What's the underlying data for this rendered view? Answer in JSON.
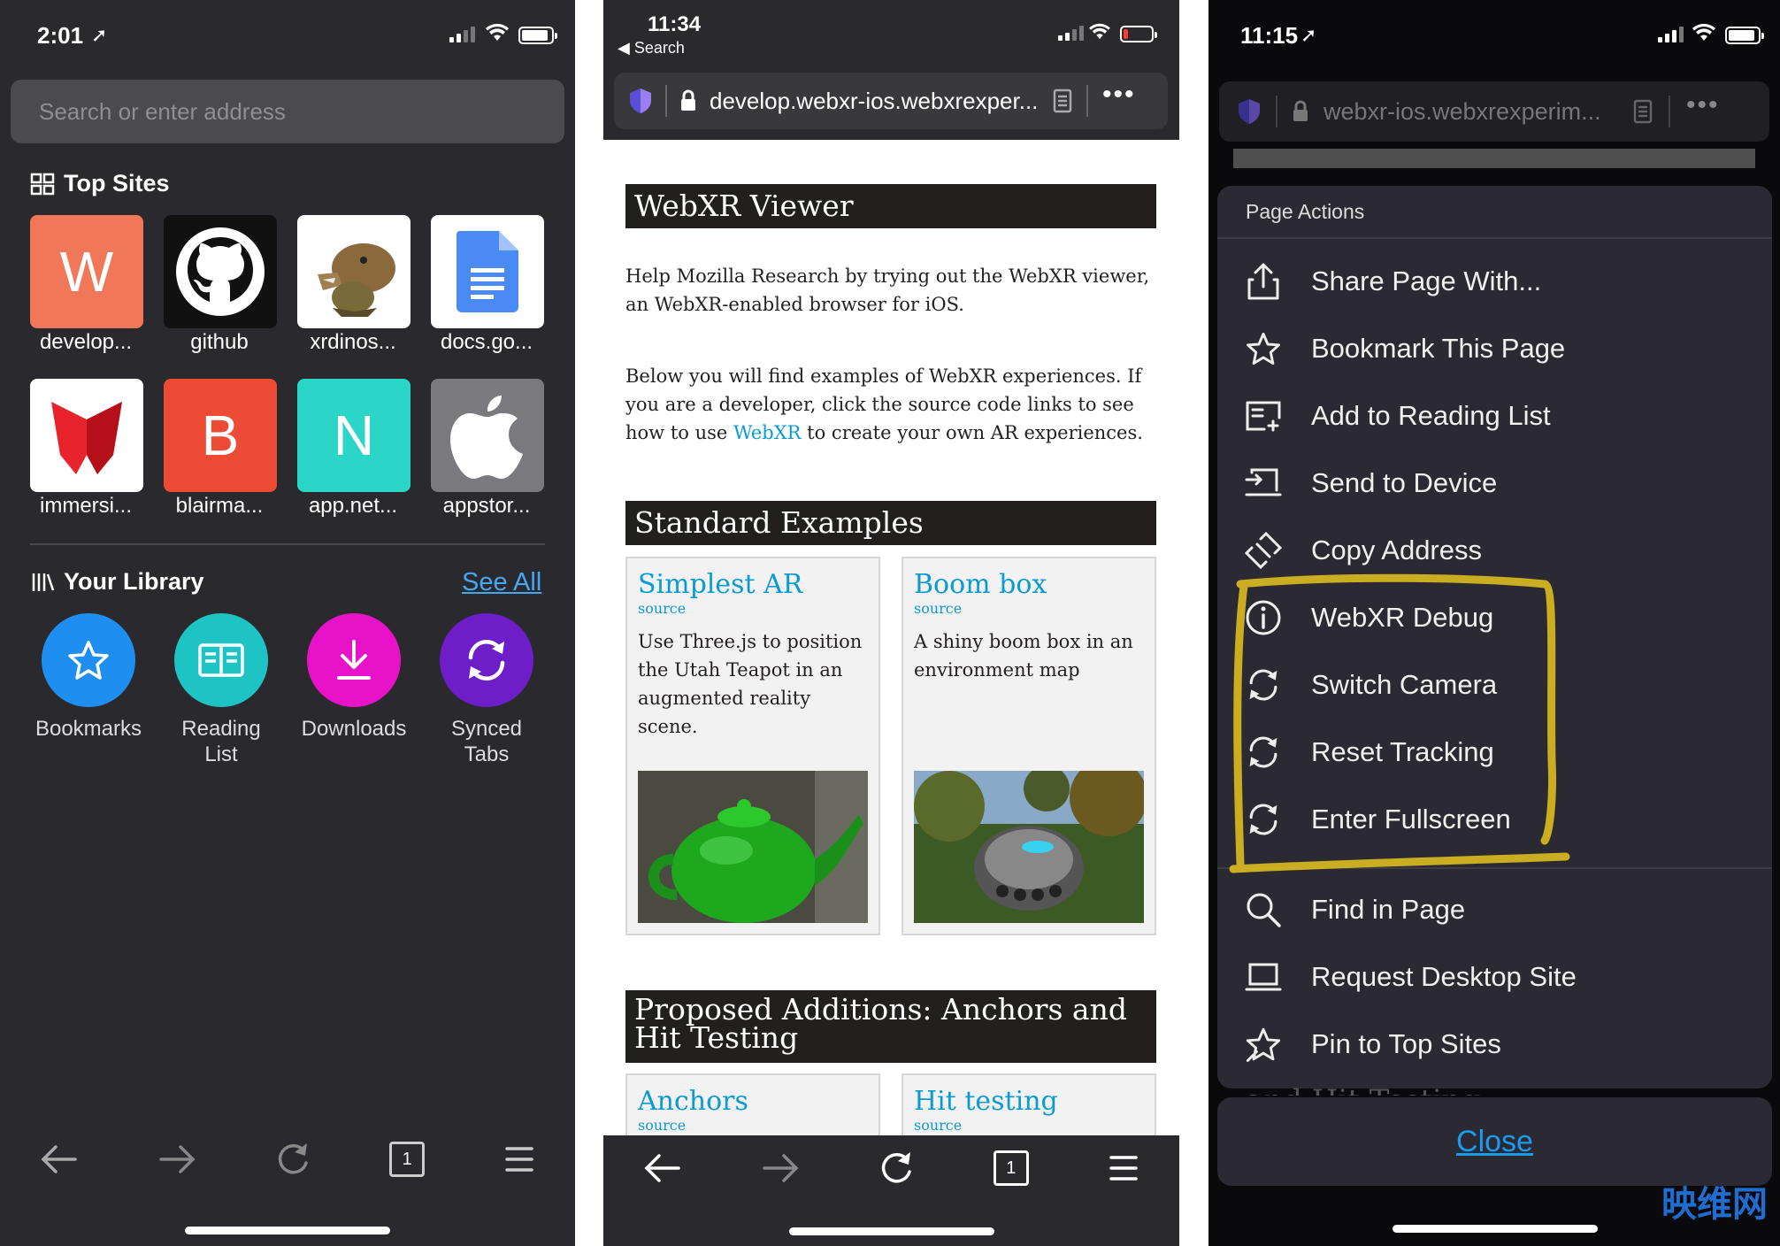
{
  "p1": {
    "status": {
      "time": "2:01"
    },
    "search_placeholder": "Search or enter address",
    "top_sites_title": "Top Sites",
    "tiles": [
      {
        "label": "develop...",
        "letter": "W",
        "bg": "#f07858"
      },
      {
        "label": "github",
        "letter": "",
        "bg": "#111111"
      },
      {
        "label": "xrdinos...",
        "letter": "",
        "bg": "#ffffff"
      },
      {
        "label": "docs.go...",
        "letter": "",
        "bg": "#ffffff"
      },
      {
        "label": "immersi...",
        "letter": "",
        "bg": "#ffffff"
      },
      {
        "label": "blairma...",
        "letter": "B",
        "bg": "#ed4b36"
      },
      {
        "label": "app.net...",
        "letter": "N",
        "bg": "#2bd6c8"
      },
      {
        "label": "appstor...",
        "letter": "",
        "bg": "#7a7a7e"
      }
    ],
    "library_title": "Your Library",
    "see_all": "See All",
    "library": [
      {
        "label": "Bookmarks",
        "bg": "#1f8ef1"
      },
      {
        "label": "Reading\nList",
        "bg": "#1ec4c4"
      },
      {
        "label": "Downloads",
        "bg": "#e813c9"
      },
      {
        "label": "Synced\nTabs",
        "bg": "#6d1ec8"
      }
    ],
    "tab_count": "1"
  },
  "p2": {
    "status": {
      "time": "11:34",
      "back": "◀ Search"
    },
    "url": "develop.webxr-ios.webxrexper...",
    "heading1": "WebXR Viewer",
    "intro": "Help Mozilla Research by trying out the WebXR viewer, an WebXR-enabled browser for iOS.",
    "body_pre": "Below you will find examples of WebXR experiences. If you are a developer, click the source code links to see how to use ",
    "body_link": "WebXR",
    "body_post": " to create your own AR experiences.",
    "heading2": "Standard Examples",
    "cards": [
      {
        "title": "Simplest AR",
        "source": "source",
        "desc": "Use Three.js to position the Utah Teapot in an augmented reality scene."
      },
      {
        "title": "Boom box",
        "source": "source",
        "desc": "A shiny boom box in an environment map"
      }
    ],
    "heading3": "Proposed Additions: Anchors and Hit Testing",
    "cards2": [
      {
        "title": "Anchors",
        "source": "source"
      },
      {
        "title": "Hit testing",
        "source": "source"
      }
    ],
    "tab_count": "1"
  },
  "p3": {
    "status": {
      "time": "11:15"
    },
    "url": "webxr-ios.webxrexperim...",
    "sheet_title": "Page Actions",
    "items": [
      {
        "label": "Share Page With...",
        "icon": "share-icon"
      },
      {
        "label": "Bookmark This Page",
        "icon": "star-icon"
      },
      {
        "label": "Add to Reading List",
        "icon": "reading-list-icon"
      },
      {
        "label": "Send to Device",
        "icon": "send-device-icon"
      },
      {
        "label": "Copy Address",
        "icon": "link-icon"
      },
      {
        "label": "WebXR Debug",
        "icon": "info-icon"
      },
      {
        "label": "Switch Camera",
        "icon": "refresh-icon"
      },
      {
        "label": "Reset Tracking",
        "icon": "refresh-icon"
      },
      {
        "label": "Enter Fullscreen",
        "icon": "refresh-icon"
      },
      {
        "label": "Find in Page",
        "icon": "search-icon"
      },
      {
        "label": "Request Desktop Site",
        "icon": "laptop-icon"
      },
      {
        "label": "Pin to Top Sites",
        "icon": "pin-icon"
      }
    ],
    "ghost_text": "and Hit Testing",
    "close": "Close",
    "highlight_color": "#d8b820"
  },
  "watermark": "映维网"
}
